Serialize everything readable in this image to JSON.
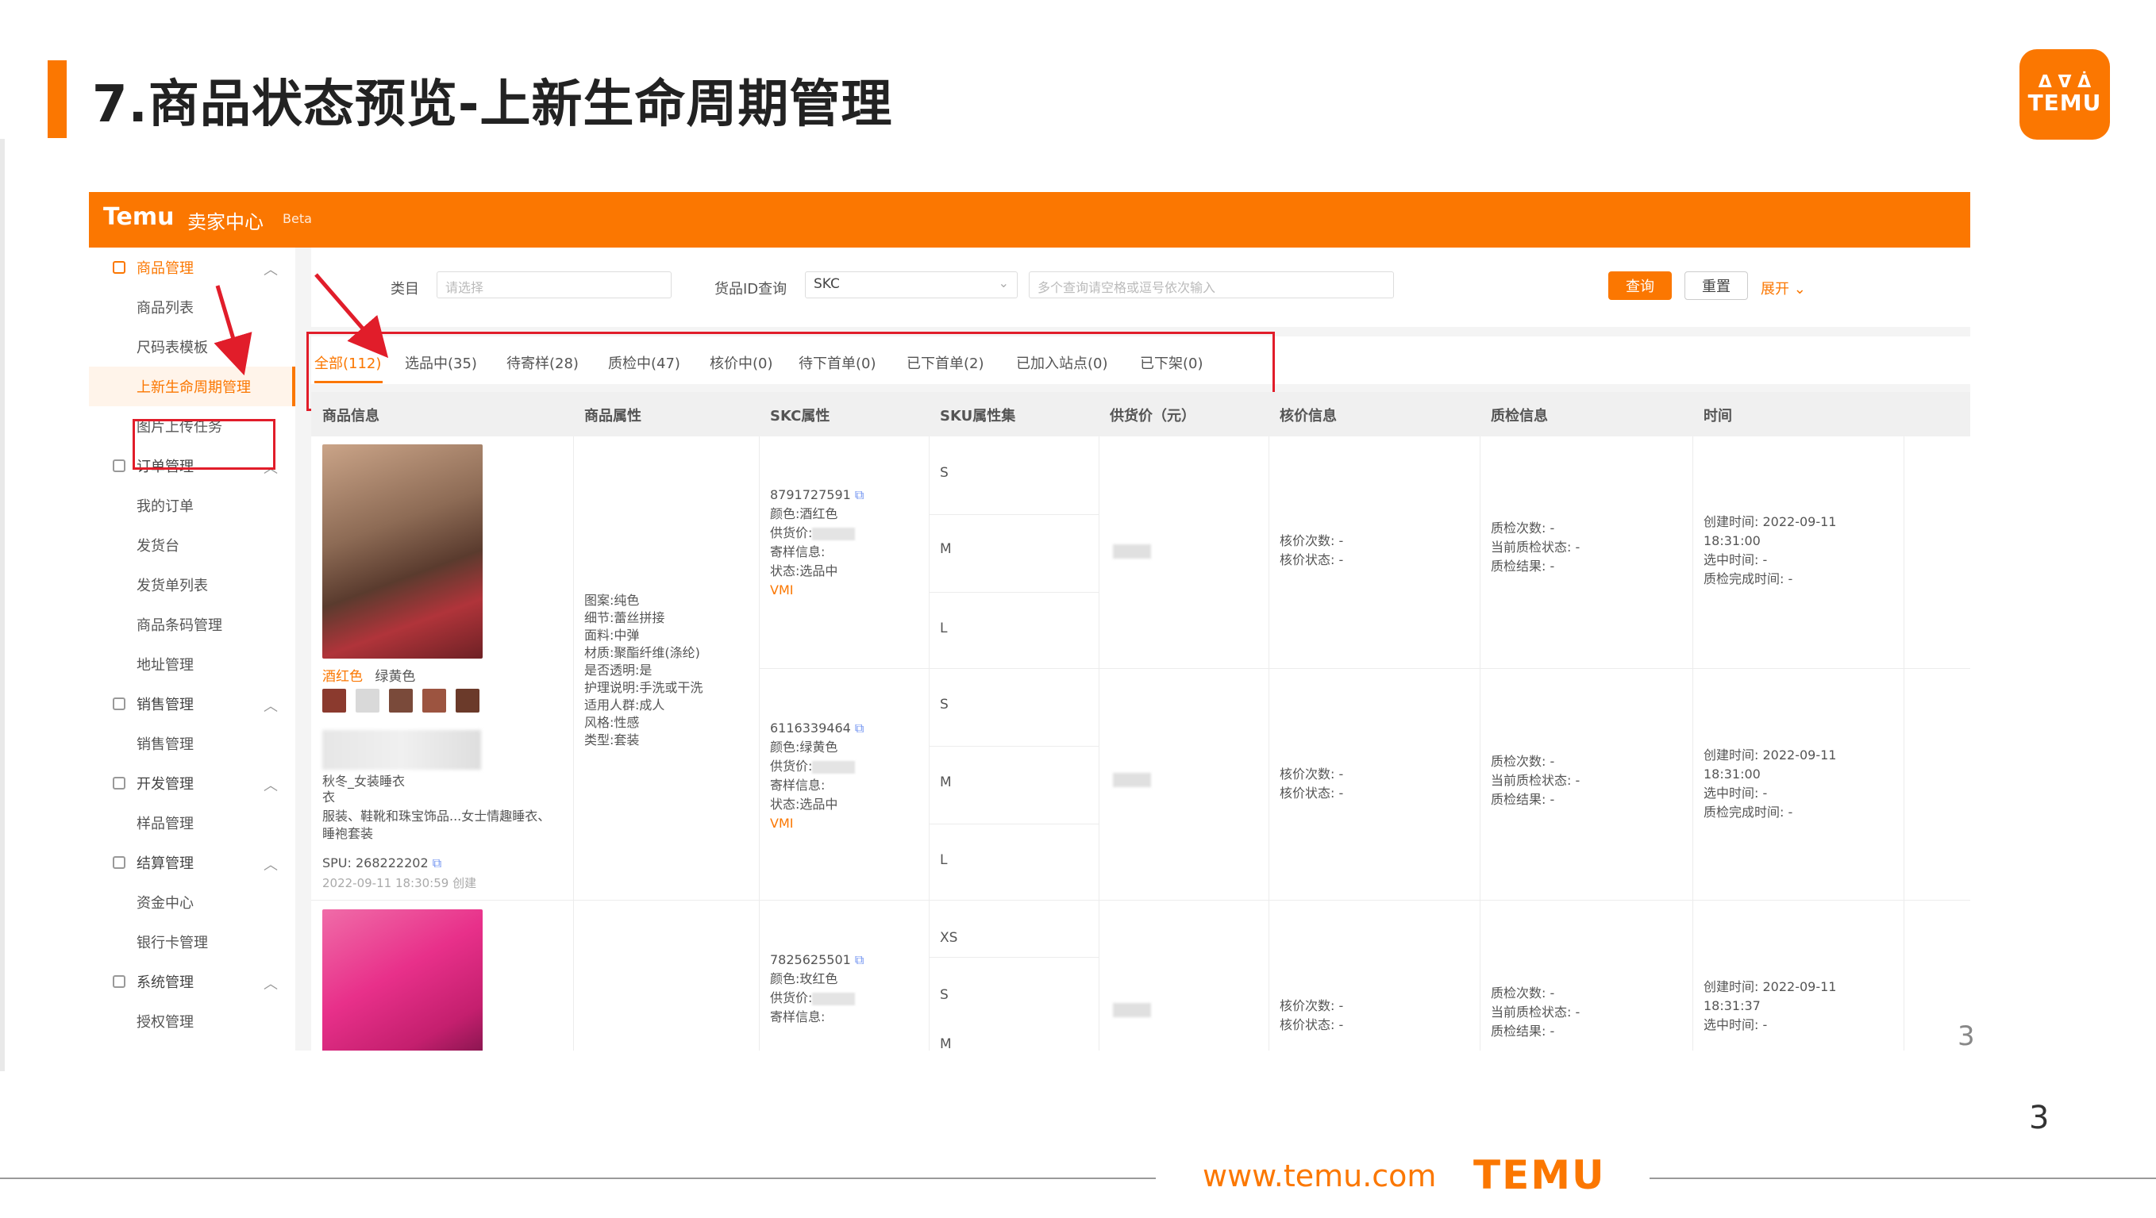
{
  "slide": {
    "title": "7.商品状态预览-上新生命周期管理",
    "logo_mark": "ᐃ ᐁ ᐄ",
    "logo_text": "TEMU",
    "page_number": "3",
    "stray_digit": "3",
    "footer_url": "www.temu.com",
    "footer_logo": "TEMU",
    "accent_color": "#fb7701",
    "highlight_color": "#e11d2a"
  },
  "app": {
    "brand": "Temu",
    "center": "卖家中心",
    "badge": "Beta"
  },
  "sidebar": {
    "groups": [
      {
        "label": "商品管理",
        "items": [
          "商品列表",
          "尺码表模板",
          "上新生命周期管理",
          "图片上传任务"
        ]
      },
      {
        "label": "订单管理",
        "items": [
          "我的订单",
          "发货台",
          "发货单列表",
          "商品条码管理",
          "地址管理"
        ]
      },
      {
        "label": "销售管理",
        "items": [
          "销售管理"
        ]
      },
      {
        "label": "开发管理",
        "items": [
          "样品管理"
        ]
      },
      {
        "label": "结算管理",
        "items": [
          "资金中心",
          "银行卡管理"
        ]
      },
      {
        "label": "系统管理",
        "items": [
          "授权管理"
        ]
      }
    ]
  },
  "filters": {
    "category_label": "类目",
    "category_placeholder": "请选择",
    "goods_id_label": "货品ID查询",
    "goods_id_type": "SKC",
    "query_placeholder": "多个查询请空格或逗号依次输入",
    "search_button": "查询",
    "reset_button": "重置",
    "expand_link": "展开"
  },
  "tabs": [
    "全部(112)",
    "选品中(35)",
    "待寄样(28)",
    "质检中(47)",
    "核价中(0)",
    "待下首单(0)",
    "已下首单(2)",
    "已加入站点(0)",
    "已下架(0)"
  ],
  "table": {
    "headers": [
      "商品信息",
      "商品属性",
      "SKC属性",
      "SKU属性集",
      "供货价（元）",
      "核价信息",
      "质检信息",
      "时间"
    ],
    "product": {
      "colors": [
        "酒红色",
        "绿黄色"
      ],
      "swatch_colors": [
        "#8b3a2e",
        "#d9d9d9",
        "#7a4a3a",
        "#9c5440",
        "#6b3a2a"
      ],
      "title_fragment": "秋冬_女装睡衣",
      "title_line2": "衣",
      "desc": "服装、鞋靴和珠宝饰品...女士情趣睡衣、睡袍套装",
      "spu_label": "SPU:",
      "spu": "268222202",
      "link_icon": "⧉",
      "created": "2022-09-11 18:30:59 创建",
      "attributes": [
        "图案:纯色",
        "细节:蕾丝拼接",
        "面料:中弹",
        "材质:聚酯纤维(涤纶)",
        "是否透明:是",
        "护理说明:手洗或干洗",
        "适用人群:成人",
        "风格:性感",
        "类型:套装"
      ]
    },
    "skc_rows": [
      {
        "id": "8791727591",
        "color_label": "颜色:",
        "color": "酒红色",
        "price_label": "供货价:",
        "sample_label": "寄样信息:",
        "status_label": "状态:",
        "status": "选品中",
        "tag": "VMI",
        "sizes": [
          "S",
          "M",
          "L"
        ]
      },
      {
        "id": "6116339464",
        "color_label": "颜色:",
        "color": "绿黄色",
        "price_label": "供货价:",
        "sample_label": "寄样信息:",
        "status_label": "状态:",
        "status": "选品中",
        "tag": "VMI",
        "sizes": [
          "S",
          "M",
          "L"
        ]
      },
      {
        "id": "7825625501",
        "color_label": "颜色:",
        "color": "玫红色",
        "price_label": "供货价:",
        "sample_label": "寄样信息:",
        "status_label": "",
        "status": "",
        "tag": "",
        "sizes": [
          "XS",
          "S",
          "M"
        ]
      }
    ],
    "pricing": {
      "count_label": "核价次数:",
      "count": "-",
      "status_label": "核价状态:",
      "status": "-"
    },
    "qc": {
      "count_label": "质检次数:",
      "count": "-",
      "current_label": "当前质检状态:",
      "current": "-",
      "result_label": "质检结果:",
      "result": "-"
    },
    "time": {
      "created_label": "创建时间:",
      "created": "2022-09-11",
      "created_time": "18:31:00",
      "created_time_3": "18:31:37",
      "selected_label": "选中时间:",
      "selected": "-",
      "qc_done_label": "质检完成时间:",
      "qc_done": "-"
    }
  }
}
